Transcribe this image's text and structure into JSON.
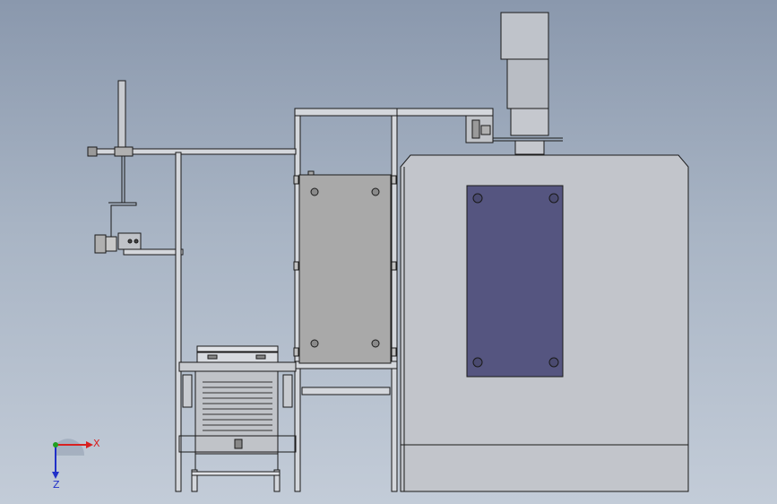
{
  "colors": {
    "background_top": "#8a98ad",
    "background_bottom": "#c3ccd8",
    "panel_fill": "#a9a9a9",
    "machine_fill": "#c2c5cb",
    "door_fill": "#555580",
    "line": "#1a1a1a",
    "x_axis": "#d82020",
    "y_axis": "#20a020",
    "z_axis": "#2030c8"
  },
  "view_triad": {
    "x_label": "X",
    "z_label": "Z",
    "icon": "coordinate-triad-icon"
  }
}
